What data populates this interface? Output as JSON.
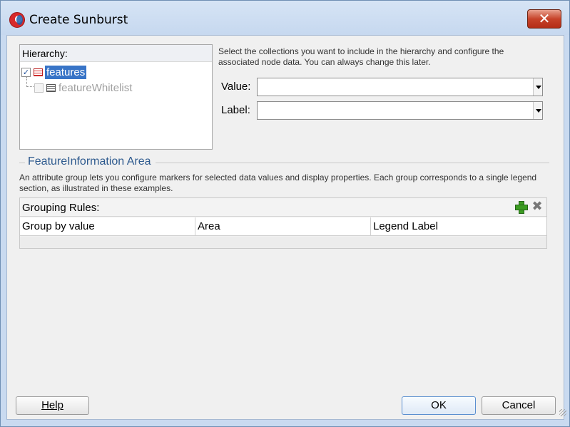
{
  "window": {
    "title": "Create Sunburst",
    "close_label": "✕"
  },
  "hierarchy": {
    "label": "Hierarchy:",
    "items": [
      {
        "label": "features",
        "checked": true,
        "selected": true,
        "enabled": true,
        "icon": "table-icon-red"
      },
      {
        "label": "featureWhitelist",
        "checked": false,
        "selected": false,
        "enabled": false,
        "icon": "table-icon"
      }
    ]
  },
  "instructions": "Select the collections you want to include in the hierarchy and configure the associated node data. You can always change this later.",
  "value_field": {
    "label": "Value:",
    "value": ""
  },
  "label_field": {
    "label": "Label:",
    "value": ""
  },
  "section": {
    "title": "FeatureInformation Area",
    "description": "An attribute group lets you configure markers for selected data values and display properties. Each group corresponds to a single legend section, as illustrated in these examples."
  },
  "grouping": {
    "title": "Grouping Rules:",
    "add_icon": "plus-icon",
    "remove_icon": "x-icon",
    "remove_glyph": "✖",
    "columns": [
      "Group by value",
      "Area",
      "Legend Label"
    ]
  },
  "buttons": {
    "help": "Help",
    "ok": "OK",
    "cancel": "Cancel"
  },
  "check_glyph": "✓"
}
